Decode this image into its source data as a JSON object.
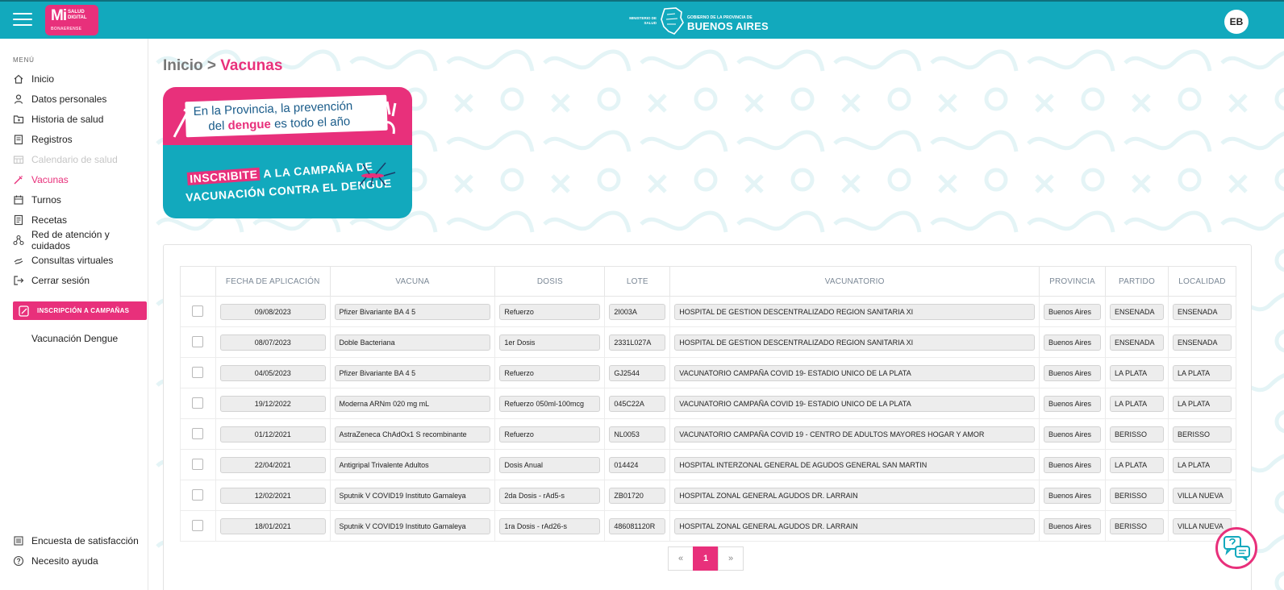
{
  "header": {
    "logo_mi": "Mi",
    "logo_line1": "SALUD",
    "logo_line2": "DIGITAL",
    "logo_line3": "BONAERENSE",
    "ministry": "MINISTERIO DE SALUD",
    "gov_line1": "GOBIERNO DE LA PROVINCIA DE",
    "gov_line2": "BUENOS AIRES",
    "avatar_initials": "EB"
  },
  "sidebar": {
    "menu_label": "MENÚ",
    "items": [
      {
        "label": "Inicio",
        "icon": "home-icon"
      },
      {
        "label": "Datos personales",
        "icon": "user-icon"
      },
      {
        "label": "Historia de salud",
        "icon": "folder-icon"
      },
      {
        "label": "Registros",
        "icon": "clipboard-icon"
      },
      {
        "label": "Calendario de salud",
        "icon": "calendar-grid-icon"
      },
      {
        "label": "Vacunas",
        "icon": "syringe-icon"
      },
      {
        "label": "Turnos",
        "icon": "calendar-icon"
      },
      {
        "label": "Recetas",
        "icon": "document-icon"
      },
      {
        "label": "Red de atención y cuidados",
        "icon": "network-icon"
      },
      {
        "label": "Consultas virtuales",
        "icon": "hand-icon"
      },
      {
        "label": "Cerrar sesión",
        "icon": "logout-icon"
      }
    ],
    "campaign_button": "INSCRIPCIÓN A CAMPAÑAS",
    "campaign_sub_item": "Vacunación Dengue",
    "bottom_items": [
      {
        "label": "Encuesta de satisfacción",
        "icon": "survey-icon"
      },
      {
        "label": "Necesito ayuda",
        "icon": "help-circle-icon"
      }
    ]
  },
  "breadcrumb": {
    "home": "Inicio",
    "separator": ">",
    "current": "Vacunas"
  },
  "banner": {
    "line1": "En la Provincia, la prevención",
    "line2_pre": "del ",
    "line2_bold": "dengue",
    "line2_post": " es todo el año",
    "cta_highlight": "INSCRIBITE",
    "cta_line1_rest": " A LA CAMPAÑA DE",
    "cta_line2": "VACUNACIÓN CONTRA EL DENGUE"
  },
  "table": {
    "columns": [
      "FECHA DE APLICACIÓN",
      "VACUNA",
      "DOSIS",
      "LOTE",
      "VACUNATORIO",
      "PROVINCIA",
      "PARTIDO",
      "LOCALIDAD"
    ],
    "rows": [
      [
        "09/08/2023",
        "Pfizer Bivariante BA 4 5",
        "Refuerzo",
        "2I003A",
        "HOSPITAL DE GESTION DESCENTRALIZADO REGION SANITARIA XI",
        "Buenos Aires",
        "ENSENADA",
        "ENSENADA"
      ],
      [
        "08/07/2023",
        "Doble Bacteriana",
        "1er Dosis",
        "2331L027A",
        "HOSPITAL DE GESTION DESCENTRALIZADO REGION SANITARIA XI",
        "Buenos Aires",
        "ENSENADA",
        "ENSENADA"
      ],
      [
        "04/05/2023",
        "Pfizer Bivariante BA 4 5",
        "Refuerzo",
        "GJ2544",
        "VACUNATORIO CAMPAÑA COVID 19- ESTADIO UNICO DE LA PLATA",
        "Buenos Aires",
        "LA PLATA",
        "LA PLATA"
      ],
      [
        "19/12/2022",
        "Moderna ARNm 020 mg mL",
        "Refuerzo 050ml-100mcg",
        "045C22A",
        "VACUNATORIO CAMPAÑA COVID 19- ESTADIO UNICO DE LA PLATA",
        "Buenos Aires",
        "LA PLATA",
        "LA PLATA"
      ],
      [
        "01/12/2021",
        "AstraZeneca ChAdOx1 S recombinante",
        "Refuerzo",
        "NL0053",
        "VACUNATORIO CAMPAÑA COVID 19 - CENTRO DE ADULTOS MAYORES HOGAR Y AMOR",
        "Buenos Aires",
        "BERISSO",
        "BERISSO"
      ],
      [
        "22/04/2021",
        "Antigripal Trivalente Adultos",
        "Dosis Anual",
        "014424",
        "HOSPITAL INTERZONAL GENERAL DE AGUDOS GENERAL SAN MARTIN",
        "Buenos Aires",
        "LA PLATA",
        "LA PLATA"
      ],
      [
        "12/02/2021",
        "Sputnik V COVID19 Instituto Gamaleya",
        "2da Dosis - rAd5-s",
        "ZB01720",
        "HOSPITAL ZONAL GENERAL AGUDOS DR. LARRAIN",
        "Buenos Aires",
        "BERISSO",
        "VILLA NUEVA"
      ],
      [
        "18/01/2021",
        "Sputnik V COVID19 Instituto Gamaleya",
        "1ra Dosis - rAd26-s",
        "486081120R",
        "HOSPITAL ZONAL GENERAL AGUDOS DR. LARRAIN",
        "Buenos Aires",
        "BERISSO",
        "VILLA NUEVA"
      ]
    ]
  },
  "pagination": {
    "prev": "«",
    "current": "1",
    "next": "»"
  },
  "colors": {
    "brand_teal": "#12a9bd",
    "brand_pink": "#e8307b"
  }
}
